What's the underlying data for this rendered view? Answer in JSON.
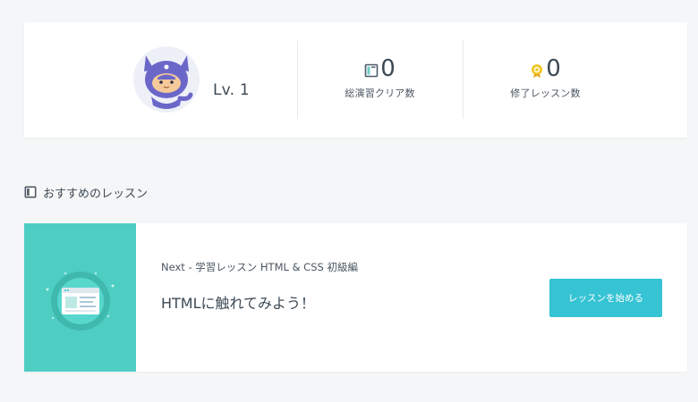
{
  "profile": {
    "level": "Lv. 1"
  },
  "stats": {
    "exercises_cleared": {
      "value": "0",
      "label": "総演習クリア数",
      "icon": "book-icon"
    },
    "lessons_completed": {
      "value": "0",
      "label": "修了レッスン数",
      "icon": "medal-icon"
    }
  },
  "recommended": {
    "section_title": "おすすめのレッスン",
    "next_label": "Next - 学習レッスン HTML & CSS 初級編",
    "lesson_title": "HTMLに触れてみよう！",
    "start_button_label": "レッスンを始める"
  },
  "colors": {
    "background": "#f5f6f7",
    "card": "#ffffff",
    "accent_teal": "#4ecec3",
    "button": "#36c3d3",
    "text": "#3d4a55",
    "avatar_purple": "#6b67c9",
    "medal_gold": "#f3c623"
  }
}
